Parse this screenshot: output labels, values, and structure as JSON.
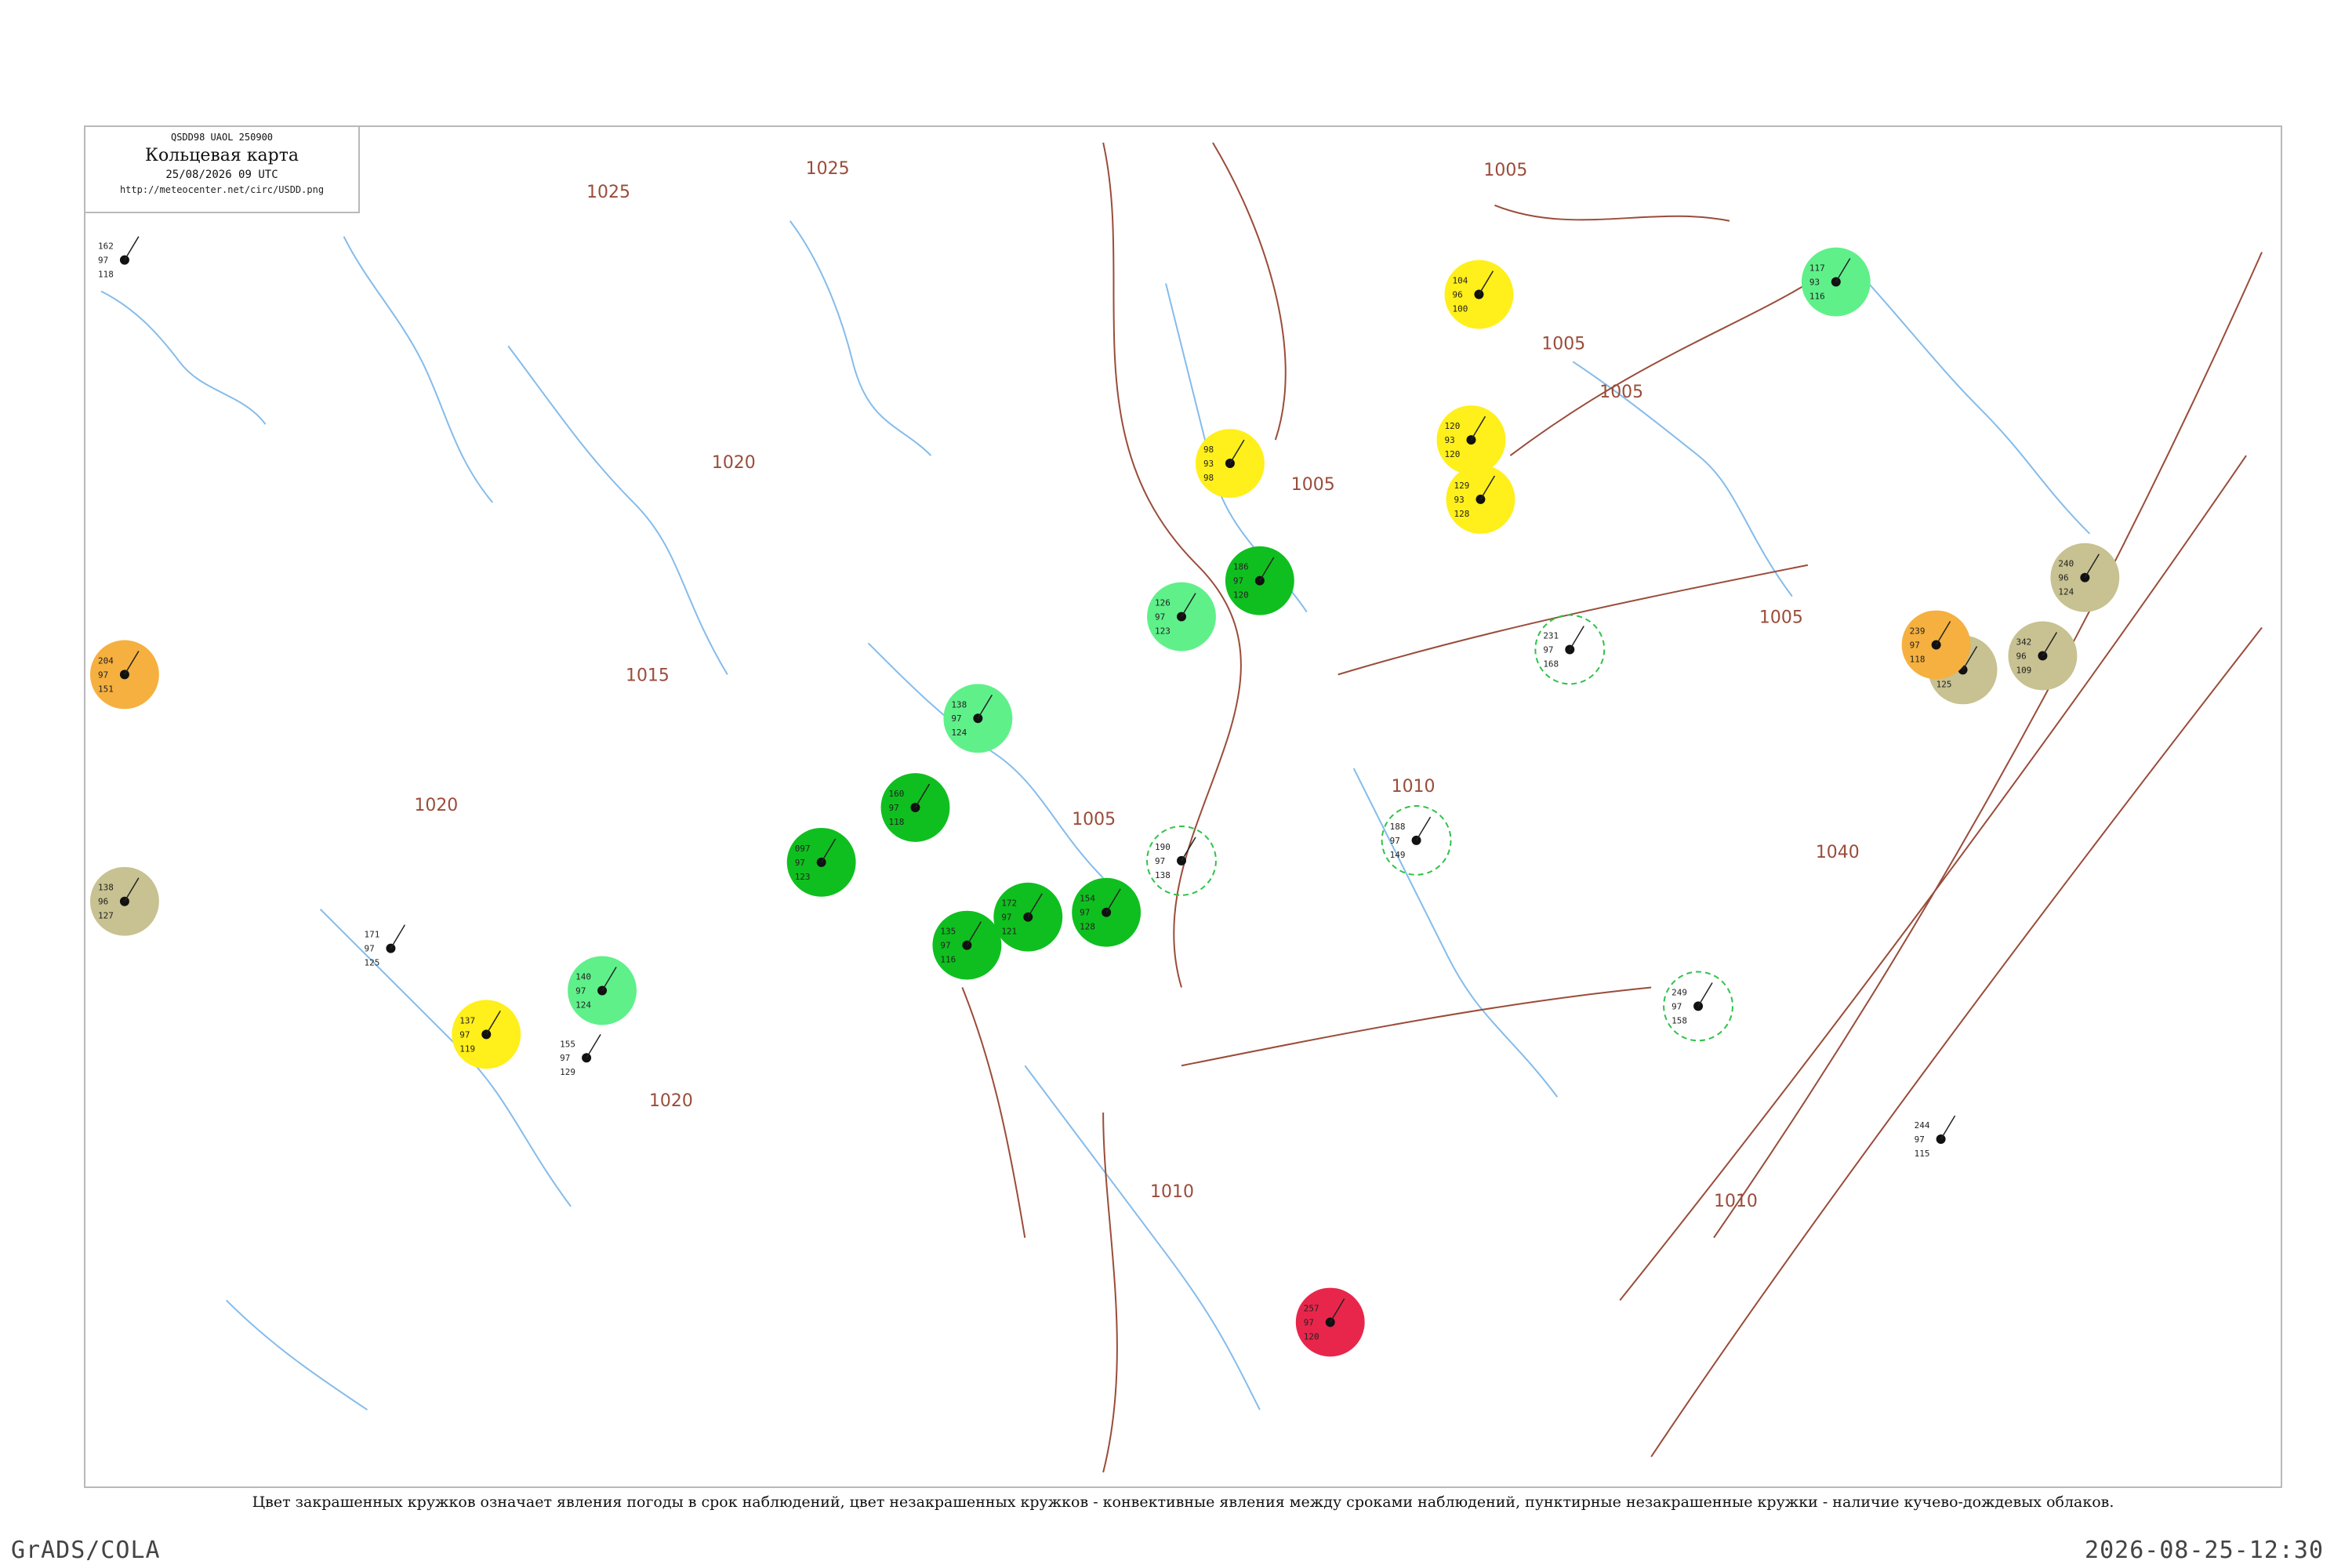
{
  "header": {
    "code": "QSDD98  UAOL  250900",
    "title": "Кольцевая карта",
    "time": "25/08/2026 09 UTC",
    "url": "http://meteocenter.net/circ/USDD.png"
  },
  "legend_text": "Цвет закрашенных кружков означает явления погоды в срок наблюдений, цвет незакрашенных кружков - конвективные явления между сроками наблюдений, пунктирные незакрашенные кружки - наличие кучево-дождевых облаков.",
  "footer": {
    "left": "GrADS/COLA",
    "right": "2026-08-25-12:30"
  },
  "colors": {
    "rain_fill": "#0fbf1f",
    "fog_fill": "#ffef1a",
    "haze_fill": "#c8c191",
    "dust_fill": "#f5b03f",
    "thunder_fill": "#e8264b",
    "shower_fill": "#5ff08a",
    "cb_ring": "#2fc24a",
    "isobar": "#9a4c3a",
    "river": "#6fb0e8"
  },
  "isobars": [
    {
      "label": "1025"
    },
    {
      "label": "1025"
    },
    {
      "label": "1020"
    },
    {
      "label": "1020"
    },
    {
      "label": "1020"
    },
    {
      "label": "1015"
    },
    {
      "label": "1005"
    },
    {
      "label": "1005"
    },
    {
      "label": "1005"
    },
    {
      "label": "1005"
    },
    {
      "label": "1005"
    },
    {
      "label": "1010"
    },
    {
      "label": "1010"
    },
    {
      "label": "1040"
    },
    {
      "label": "1005"
    },
    {
      "label": "1010"
    }
  ],
  "stations": [
    {
      "top": "162",
      "mid": "97",
      "bot": "118",
      "kind": "plain"
    },
    {
      "top": "204",
      "mid": "97",
      "bot": "151",
      "kind": "dust"
    },
    {
      "top": "138",
      "mid": "96",
      "bot": "127",
      "kind": "haze"
    },
    {
      "top": "137",
      "mid": "97",
      "bot": "119",
      "kind": "fog"
    },
    {
      "top": "98",
      "mid": "93",
      "bot": "98",
      "kind": "fog"
    },
    {
      "top": "104",
      "mid": "96",
      "bot": "100",
      "kind": "fog"
    },
    {
      "top": "120",
      "mid": "93",
      "bot": "120",
      "kind": "fog"
    },
    {
      "top": "129",
      "mid": "93",
      "bot": "128",
      "kind": "fog"
    },
    {
      "top": "117",
      "mid": "93",
      "bot": "116",
      "kind": "shower"
    },
    {
      "top": "126",
      "mid": "97",
      "bot": "123",
      "kind": "shower"
    },
    {
      "top": "140",
      "mid": "97",
      "bot": "124",
      "kind": "shower"
    },
    {
      "top": "138",
      "mid": "97",
      "bot": "124",
      "kind": "shower"
    },
    {
      "top": "240",
      "mid": "96",
      "bot": "124",
      "kind": "haze"
    },
    {
      "top": "342",
      "mid": "96",
      "bot": "109",
      "kind": "haze"
    },
    {
      "top": "259",
      "mid": "96",
      "bot": "125",
      "kind": "haze"
    },
    {
      "top": "239",
      "mid": "97",
      "bot": "118",
      "kind": "dust"
    },
    {
      "top": "257",
      "mid": "97",
      "bot": "120",
      "kind": "thunder"
    },
    {
      "top": "097",
      "mid": "97",
      "bot": "123",
      "kind": "rain"
    },
    {
      "top": "160",
      "mid": "97",
      "bot": "118",
      "kind": "rain"
    },
    {
      "top": "135",
      "mid": "97",
      "bot": "116",
      "kind": "rain"
    },
    {
      "top": "172",
      "mid": "97",
      "bot": "121",
      "kind": "rain"
    },
    {
      "top": "154",
      "mid": "97",
      "bot": "128",
      "kind": "rain"
    },
    {
      "top": "186",
      "mid": "97",
      "bot": "120",
      "kind": "rain"
    },
    {
      "top": "231",
      "mid": "97",
      "bot": "168",
      "kind": "cb"
    },
    {
      "top": "188",
      "mid": "97",
      "bot": "149",
      "kind": "cb"
    },
    {
      "top": "190",
      "mid": "97",
      "bot": "138",
      "kind": "cb"
    },
    {
      "top": "249",
      "mid": "97",
      "bot": "158",
      "kind": "cb"
    },
    {
      "top": "155",
      "mid": "97",
      "bot": "129",
      "kind": "plain"
    },
    {
      "top": "244",
      "mid": "97",
      "bot": "115",
      "kind": "plain"
    },
    {
      "top": "171",
      "mid": "97",
      "bot": "125",
      "kind": "plain"
    }
  ]
}
